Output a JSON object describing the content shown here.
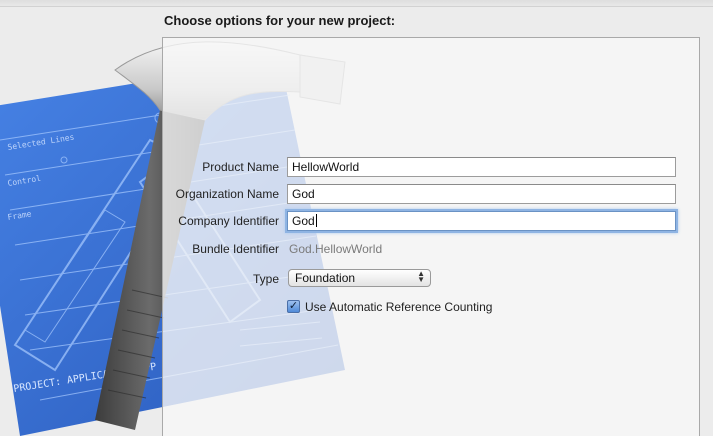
{
  "heading": "Choose options for your new project:",
  "form": {
    "product_name": {
      "label": "Product Name",
      "value": "HellowWorld"
    },
    "organization_name": {
      "label": "Organization Name",
      "value": "God"
    },
    "company_identifier": {
      "label": "Company Identifier",
      "value": "God"
    },
    "bundle_identifier": {
      "label": "Bundle Identifier",
      "value": "God.HellowWorld"
    },
    "type": {
      "label": "Type",
      "selected": "Foundation"
    },
    "arc": {
      "label": "Use Automatic Reference Counting",
      "checked": true
    }
  },
  "artwork": {
    "blueprint_text": "PROJECT: APPLICATION.APP"
  },
  "colors": {
    "focus_ring": "#8fb4e3",
    "checkbox_fill": "#4f8bd9",
    "blueprint": "#2e63c8"
  }
}
